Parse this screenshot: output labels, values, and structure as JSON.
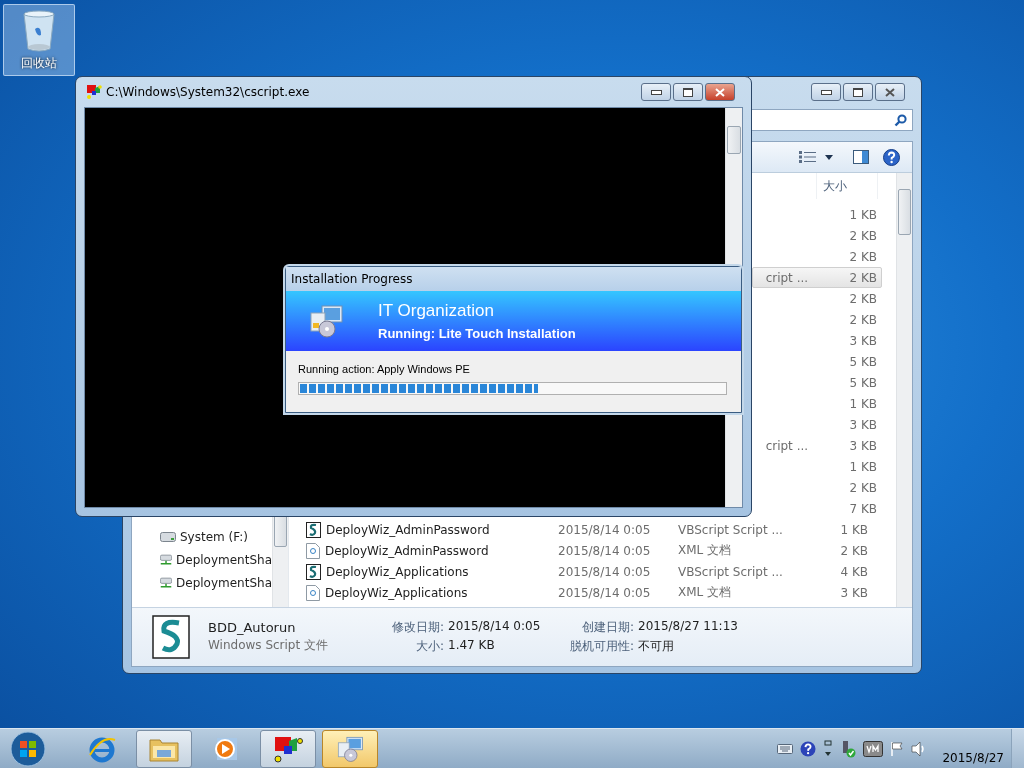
{
  "desktop": {
    "icons": [
      {
        "label": "回收站",
        "kind": "recycle-bin",
        "selected": true
      }
    ]
  },
  "explorer": {
    "column_header": "大小",
    "nav_items": [
      {
        "label": "System (F:)",
        "kind": "drive"
      },
      {
        "label": "DeploymentSha",
        "kind": "network"
      },
      {
        "label": "DeploymentSha",
        "kind": "network"
      }
    ],
    "files": [
      {
        "kind": "partial",
        "size": "1 KB",
        "selected": false
      },
      {
        "kind": "partial",
        "size": "2 KB",
        "selected": false
      },
      {
        "kind": "partial",
        "size": "2 KB",
        "selected": false
      },
      {
        "kind": "partial",
        "type": "cript ...",
        "size": "2 KB",
        "selected": true
      },
      {
        "kind": "partial",
        "size": "2 KB",
        "selected": false
      },
      {
        "kind": "partial",
        "size": "2 KB",
        "selected": false
      },
      {
        "kind": "partial",
        "size": "3 KB",
        "selected": false
      },
      {
        "kind": "partial",
        "size": "5 KB",
        "selected": false
      },
      {
        "kind": "partial",
        "size": "5 KB",
        "selected": false
      },
      {
        "kind": "partial",
        "size": "1 KB",
        "selected": false
      },
      {
        "kind": "partial",
        "size": "3 KB",
        "selected": false
      },
      {
        "kind": "partial",
        "type": "cript ...",
        "size": "3 KB",
        "selected": false
      },
      {
        "kind": "partial",
        "size": "1 KB",
        "selected": false
      },
      {
        "kind": "partial",
        "size": "2 KB",
        "selected": false
      },
      {
        "kind": "partial",
        "size": "7 KB",
        "selected": false
      },
      {
        "kind": "script",
        "name": "DeployWiz_AdminPassword",
        "date": "2015/8/14 0:05",
        "type": "VBScript Script ...",
        "size": "1 KB",
        "selected": false
      },
      {
        "kind": "xml",
        "name": "DeployWiz_AdminPassword",
        "date": "2015/8/14 0:05",
        "type": "XML 文档",
        "size": "2 KB",
        "selected": false
      },
      {
        "kind": "script",
        "name": "DeployWiz_Applications",
        "date": "2015/8/14 0:05",
        "type": "VBScript Script ...",
        "size": "4 KB",
        "selected": false
      },
      {
        "kind": "xml",
        "name": "DeployWiz_Applications",
        "date": "2015/8/14 0:05",
        "type": "XML 文档",
        "size": "3 KB",
        "selected": false
      }
    ],
    "details": {
      "name": "BDD_Autorun",
      "type": "Windows Script 文件",
      "fields": [
        {
          "label": "修改日期:",
          "value": "2015/8/14 0:05"
        },
        {
          "label": "创建日期:",
          "value": "2015/8/27 11:13"
        },
        {
          "label": "大小:",
          "value": "1.47 KB"
        },
        {
          "label": "脱机可用性:",
          "value": "不可用"
        }
      ]
    }
  },
  "console": {
    "title": "C:\\Windows\\System32\\cscript.exe"
  },
  "progress_dialog": {
    "title": "Installation Progress",
    "organization": "IT Organization",
    "status": "Running: Lite Touch Installation",
    "action": "Running action: Apply Windows PE",
    "level": 0.56
  },
  "taskbar": {
    "apps": [
      {
        "kind": "browser",
        "running": false,
        "selected": false
      },
      {
        "kind": "folder",
        "running": true,
        "selected": false
      },
      {
        "kind": "media",
        "running": false,
        "selected": false
      },
      {
        "kind": "shapes",
        "running": true,
        "selected": false
      },
      {
        "kind": "deploy",
        "running": true,
        "selected": true
      }
    ],
    "date": "2015/8/27"
  }
}
